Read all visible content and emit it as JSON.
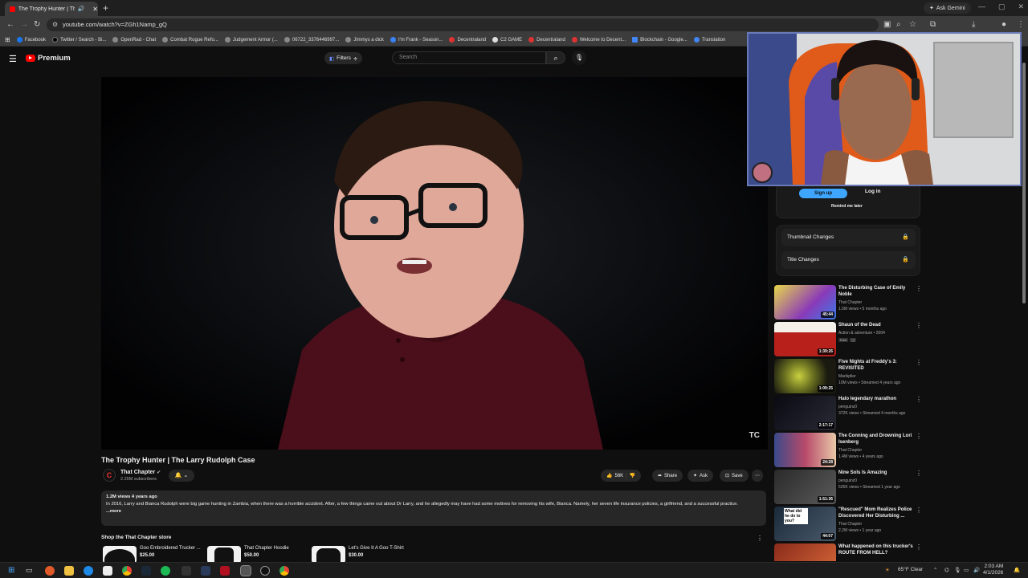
{
  "browser": {
    "tab_title": "The Trophy Hunter | The La...",
    "url": "youtube.com/watch?v=ZGh1Namp_gQ",
    "ask_gemini": "Ask Gemini",
    "bookmarks": [
      "Facebook",
      "Twitter / Search - Bi...",
      "OpenRad - Chat",
      "Combat Rogue Refo...",
      "Judgement Armor (...",
      "06722_3376446997...",
      "Jimmys a dick",
      "I'm Frank - Season...",
      "Decentraland",
      "C2 GAME",
      "Decentraland",
      "Welcome to Decent...",
      "Blockchain - Google...",
      "Translation"
    ]
  },
  "youtube": {
    "logo_text": "Premium",
    "filters_label": "Filters",
    "search_placeholder": "Search",
    "video": {
      "title": "The Trophy Hunter | The Larry Rudolph Case",
      "watermark": "TC",
      "channel_name": "That Chapter",
      "channel_initial": "C",
      "subscribers": "2.25M subscribers",
      "likes": "56K",
      "share_label": "Share",
      "ask_label": "Ask",
      "save_label": "Save",
      "views_line": "1.2M views  4 years ago",
      "description": "In 2016, Larry and Bianca Rudolph were big game hunting in Zambia, when there was a horrible accident. After, a few things came out about Dr Larry, and he allegedly may have had some motives for removing his wife, Bianca. Namely, her seven life insurance policies, a girlfriend, and a successful practice.",
      "more_label": "...more"
    },
    "shop": {
      "title": "Shop the That Chapter store",
      "items": [
        {
          "name": "Goo Embroidered Trucker ...",
          "price": "$25.00"
        },
        {
          "name": "That Chapter Hoodie",
          "price": "$50.00"
        },
        {
          "name": "Let's Give It A Goo T-Shirt",
          "price": "$30.00"
        }
      ]
    },
    "signin": {
      "signup": "Sign up",
      "login": "Log in",
      "remind": "Remind me later"
    },
    "locked": [
      "Thumbnail Changes",
      "Title Changes"
    ],
    "recommendations": [
      {
        "title": "The Disturbing Case of Emily Noble",
        "channel": "That Chapter",
        "meta": "1.5M views • 5 months ago",
        "duration": "45:44",
        "color": "#c7b84a"
      },
      {
        "title": "Shaun of the Dead",
        "channel": "Action & adventure • 2004",
        "meta": "Free",
        "duration": "1:39:26",
        "color": "#b8201c"
      },
      {
        "title": "Five Nights at Freddy's 3: REVISITED",
        "channel": "Markiplier",
        "meta": "10M views • Streamed 4 years ago",
        "duration": "1:09:25",
        "color": "#5a6a20"
      },
      {
        "title": "Halo legendary marathon",
        "channel": "penguinz0",
        "meta": "372K views • Streamed 4 months ago",
        "duration": "2:17:17",
        "color": "#1a1a22"
      },
      {
        "title": "The Conning and Drowning Lori Isenberg",
        "channel": "That Chapter",
        "meta": "1.4M views • 4 years ago",
        "duration": "24:28",
        "color": "#8a3a6a"
      },
      {
        "title": "Nine Sols Is Amazing",
        "channel": "penguinz0",
        "meta": "526K views • Streamed 1 year ago",
        "duration": "1:51:36",
        "color": "#3a3a3a"
      },
      {
        "title": "\"Rescued\" Mom Realizes Police Discovered Her Disturbing ...",
        "channel": "That Chapter",
        "meta": "2.2M views • 1 year ago",
        "duration": "44:07",
        "color": "#2a3a4a"
      },
      {
        "title": "What happened on this trucker's ROUTE FROM HELL?",
        "channel": "",
        "meta": "",
        "duration": "",
        "color": "#7a2a1a"
      }
    ],
    "recommendation_extra": {
      "thumb7_text": "What did he do to you?"
    }
  },
  "taskbar": {
    "weather": "65°F  Clear",
    "time": "2:03 AM",
    "date": "4/1/2026"
  }
}
